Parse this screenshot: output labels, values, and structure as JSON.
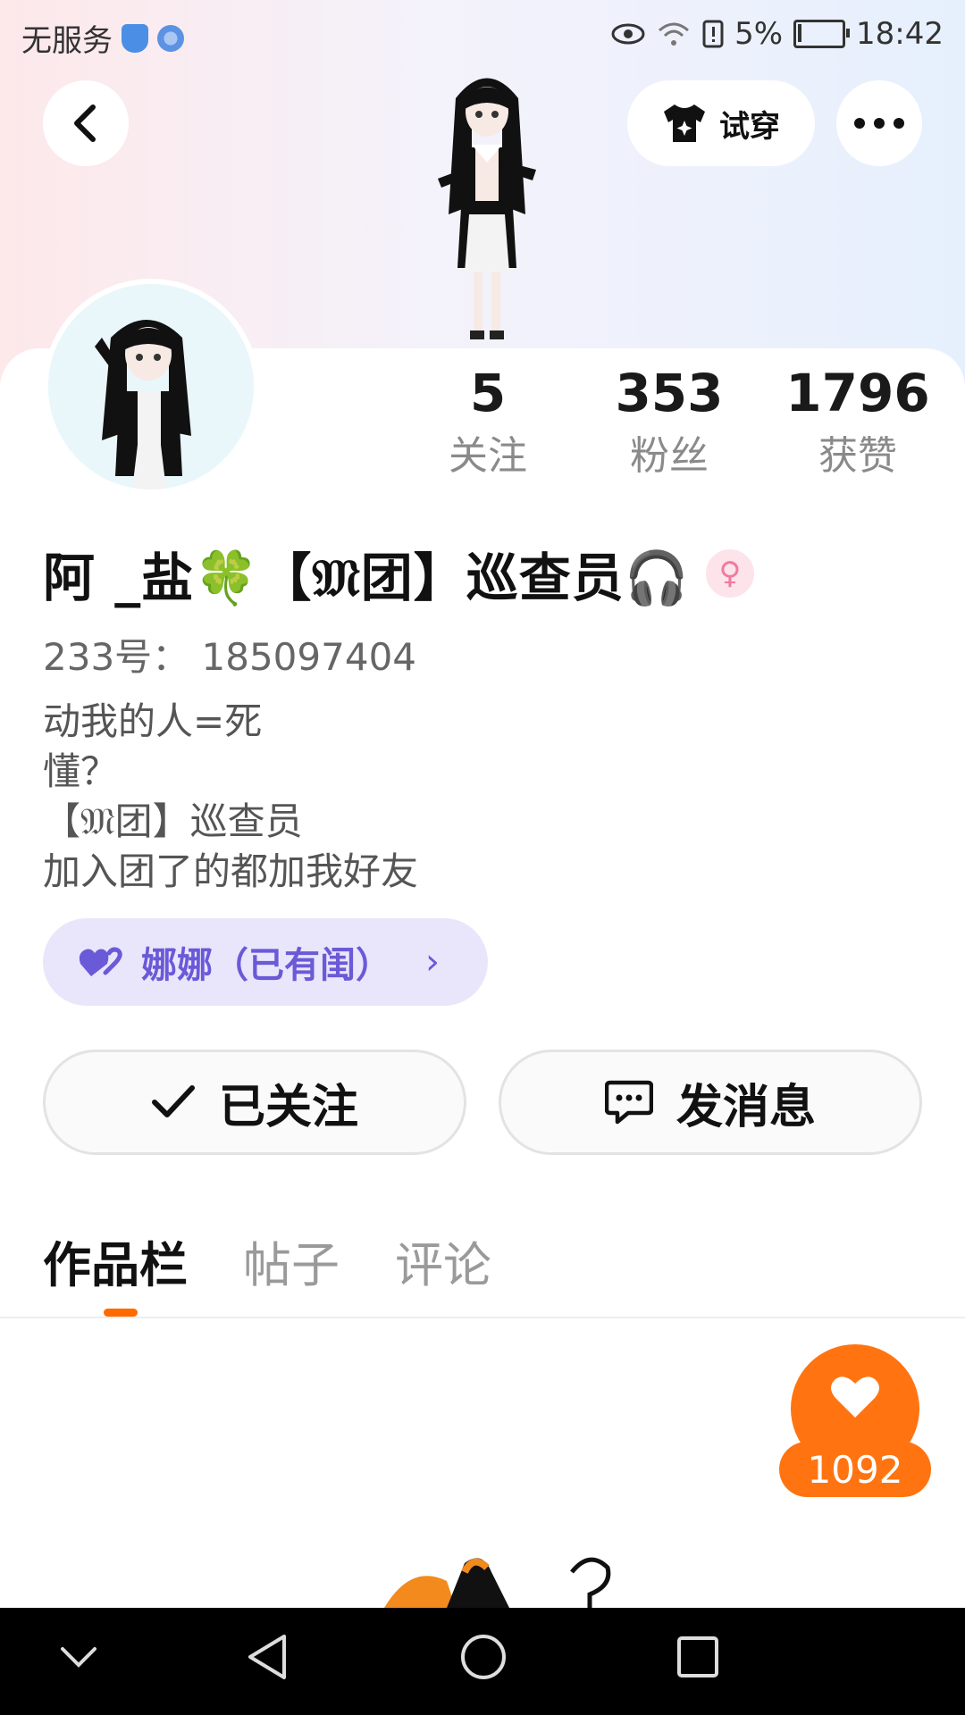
{
  "status_bar": {
    "carrier": "无服务",
    "battery": "5%",
    "time": "18:42"
  },
  "header": {
    "tryon_label": "试穿"
  },
  "stats": [
    {
      "value": "5",
      "label": "关注"
    },
    {
      "value": "353",
      "label": "粉丝"
    },
    {
      "value": "1796",
      "label": "获赞"
    }
  ],
  "profile": {
    "name": "阿 _盐🍀【𝔐团】巡查员🎧",
    "gender_symbol": "♀",
    "uid": "233号： 185097404",
    "bio": [
      "动我的人=死",
      "懂？",
      "【𝔐团】巡查员",
      "加入团了的都加我好友"
    ],
    "cp_tag": "娜娜（已有闺）"
  },
  "actions": {
    "follow": "已关注",
    "message": "发消息"
  },
  "tabs": [
    {
      "label": "作品栏",
      "active": true
    },
    {
      "label": "帖子",
      "active": false
    },
    {
      "label": "评论",
      "active": false
    }
  ],
  "likes": {
    "count": "1092"
  },
  "colors": {
    "accent": "#ff7411",
    "cp_tag_text": "#6a5ad8",
    "cp_tag_bg": "#e9e6fb"
  }
}
